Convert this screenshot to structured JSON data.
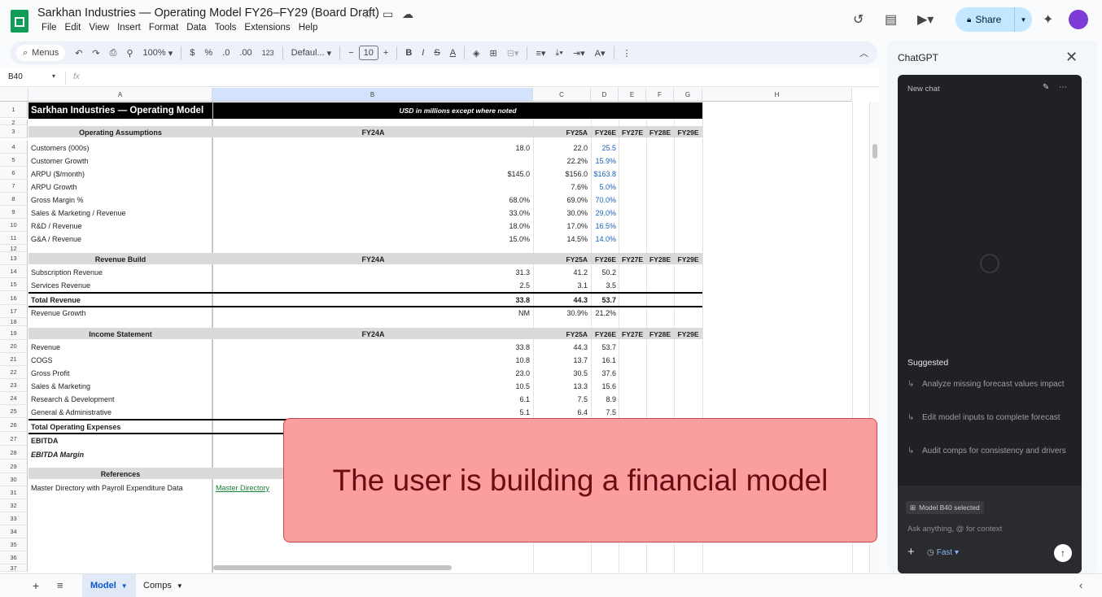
{
  "doc": {
    "title": "Sarkhan Industries — Operating Model FY26–FY29 (Board Draft)",
    "menu": [
      "File",
      "Edit",
      "View",
      "Insert",
      "Format",
      "Data",
      "Tools",
      "Extensions",
      "Help"
    ],
    "share_label": "Share"
  },
  "toolbar": {
    "menus_label": "Menus",
    "zoom": "100%",
    "currency": "$",
    "percent": "%",
    "dec_less": ".0",
    "dec_more": ".00",
    "num_fmt": "123",
    "font": "Defaul...",
    "font_size": "10"
  },
  "formula_bar": {
    "cell_ref": "B40",
    "fx": "fx"
  },
  "columns": [
    "A",
    "B",
    "C",
    "D",
    "E",
    "F",
    "G",
    "H"
  ],
  "rows": [
    "1",
    "2",
    "3",
    "4",
    "5",
    "6",
    "7",
    "8",
    "9",
    "10",
    "11",
    "12",
    "13",
    "14",
    "15",
    "16",
    "17",
    "18",
    "19",
    "20",
    "21",
    "22",
    "23",
    "24",
    "25",
    "26",
    "27",
    "28",
    "29",
    "30",
    "31",
    "32",
    "33",
    "34",
    "35",
    "36",
    "37"
  ],
  "sheet": {
    "title": "Sarkhan Industries — Operating Model",
    "subtitle": "USD in millions except where noted",
    "years": [
      "FY24A",
      "FY25A",
      "FY26E",
      "FY27E",
      "FY28E",
      "FY29E"
    ],
    "sections": {
      "assumptions": "Operating Assumptions",
      "revenue": "Revenue Build",
      "income": "Income Statement",
      "references": "References"
    },
    "assumptions": [
      {
        "label": "Customers (000s)",
        "fy24": "18.0",
        "fy25": "22.0",
        "fy26": "25.5"
      },
      {
        "label": "Customer Growth",
        "fy24": "",
        "fy25": "22.2%",
        "fy26": "15.9%"
      },
      {
        "label": "ARPU ($/month)",
        "fy24": "$145.0",
        "fy25": "$156.0",
        "fy26": "$163.8"
      },
      {
        "label": "ARPU Growth",
        "fy24": "",
        "fy25": "7.6%",
        "fy26": "5.0%"
      },
      {
        "label": "Gross Margin %",
        "fy24": "68.0%",
        "fy25": "69.0%",
        "fy26": "70.0%"
      },
      {
        "label": "Sales & Marketing / Revenue",
        "fy24": "33.0%",
        "fy25": "30.0%",
        "fy26": "29.0%"
      },
      {
        "label": "R&D / Revenue",
        "fy24": "18.0%",
        "fy25": "17.0%",
        "fy26": "16.5%"
      },
      {
        "label": "G&A / Revenue",
        "fy24": "15.0%",
        "fy25": "14.5%",
        "fy26": "14.0%"
      }
    ],
    "revenue": [
      {
        "label": "Subscription Revenue",
        "fy24": "31.3",
        "fy25": "41.2",
        "fy26": "50.2"
      },
      {
        "label": "Services Revenue",
        "fy24": "2.5",
        "fy25": "3.1",
        "fy26": "3.5"
      },
      {
        "label": "Total Revenue",
        "fy24": "33.8",
        "fy25": "44.3",
        "fy26": "53.7"
      },
      {
        "label": "Revenue Growth",
        "fy24": "NM",
        "fy25": "30.9%",
        "fy26": "21.2%"
      }
    ],
    "income": [
      {
        "label": "Revenue",
        "fy24": "33.8",
        "fy25": "44.3",
        "fy26": "53.7"
      },
      {
        "label": "COGS",
        "fy24": "10.8",
        "fy25": "13.7",
        "fy26": "16.1"
      },
      {
        "label": "Gross Profit",
        "fy24": "23.0",
        "fy25": "30.5",
        "fy26": "37.6"
      },
      {
        "label": "Sales & Marketing",
        "fy24": "10.5",
        "fy25": "13.3",
        "fy26": "15.6"
      },
      {
        "label": "Research & Development",
        "fy24": "6.1",
        "fy25": "7.5",
        "fy26": "8.9"
      },
      {
        "label": "General & Administrative",
        "fy24": "5.1",
        "fy25": "6.4",
        "fy26": "7.5"
      }
    ],
    "totals": {
      "total_opex": "Total Operating Expenses",
      "ebitda": "EBITDA",
      "ebitda_margin": "EBITDA Margin"
    },
    "reference_row": {
      "label": "Master Directory with Payroll Expenditure Data",
      "link": "Master Directory"
    }
  },
  "sheet_tabs": [
    "Model",
    "Comps"
  ],
  "chatgpt": {
    "title": "ChatGPT",
    "new_chat": "New chat",
    "suggested": "Suggested",
    "suggestions": [
      "Analyze missing forecast values impact",
      "Edit model inputs to complete forecast",
      "Audit comps for consistency and drivers"
    ],
    "context_chip": "Model B40 selected",
    "placeholder": "Ask anything, @ for context",
    "mode": "Fast"
  },
  "overlay": {
    "text": "The user is building a financial model"
  },
  "colors": {
    "accent": "#0b57d0",
    "overlay_bg": "#fb9e9f",
    "overlay_text": "#6b0c10",
    "forecast_blue": "#1a62b8"
  }
}
